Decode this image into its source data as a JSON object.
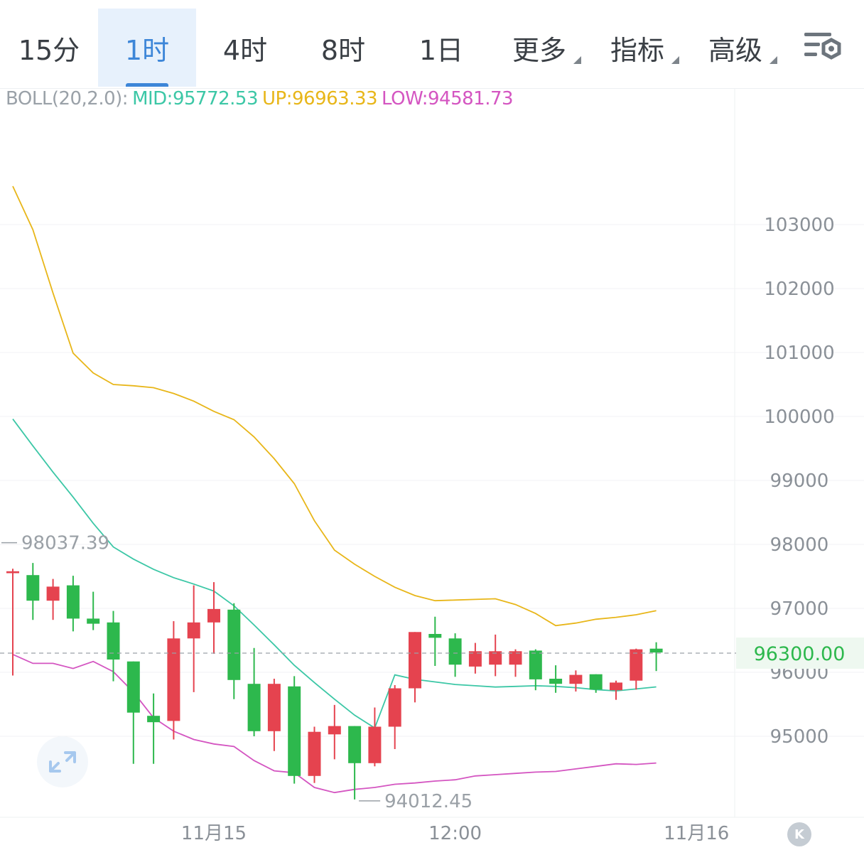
{
  "tabs": [
    {
      "label": "15分",
      "active": false,
      "has_dropdown": false
    },
    {
      "label": "1时",
      "active": true,
      "has_dropdown": false
    },
    {
      "label": "4时",
      "active": false,
      "has_dropdown": false
    },
    {
      "label": "8时",
      "active": false,
      "has_dropdown": false
    },
    {
      "label": "1日",
      "active": false,
      "has_dropdown": false
    },
    {
      "label": "更多",
      "active": false,
      "has_dropdown": true
    },
    {
      "label": "指标",
      "active": false,
      "has_dropdown": true
    },
    {
      "label": "高级",
      "active": false,
      "has_dropdown": true
    }
  ],
  "settings_icon": "chart-settings-icon",
  "indicator": {
    "name": "BOLL(20,2.0):",
    "mid": "MID:95772.53",
    "up": "UP:96963.33",
    "low": "LOW:94581.73"
  },
  "colors": {
    "up_candle": "#e5434f",
    "down_candle": "#2db84d",
    "mid": "#3cc7a6",
    "upper": "#e8b619",
    "lower": "#d455c1",
    "active_tab": "#3d86d8",
    "current_price": "#2db84d"
  },
  "current_price": "96300.00",
  "expand_icon": "expand-arrows-icon",
  "k_button_label": "K",
  "chart_data": {
    "type": "candlestick",
    "interval": "1h",
    "ylim": [
      93900,
      104000
    ],
    "y_ticks": [
      95000,
      96000,
      97000,
      98000,
      99000,
      100000,
      101000,
      102000,
      103000
    ],
    "y_tick_labels": [
      "95000",
      "96000",
      "97000",
      "98000",
      "99000",
      "100000",
      "101000",
      "102000",
      "103000"
    ],
    "x_labels": [
      {
        "label": "11月15",
        "index": 10
      },
      {
        "label": "12:00",
        "index": 22
      },
      {
        "label": "11月16",
        "index": 34
      }
    ],
    "annotations": {
      "high": {
        "label": "98037.39",
        "value": 98037.39,
        "index": 1
      },
      "low": {
        "label": "94012.45",
        "value": 94012.45,
        "index": 17
      }
    },
    "current_price": 96300.0,
    "candles": [
      {
        "o": 97550,
        "h": 97620,
        "l": 95950,
        "c": 97580
      },
      {
        "o": 97520,
        "h": 97710,
        "l": 96820,
        "c": 97120
      },
      {
        "o": 97120,
        "h": 97460,
        "l": 96820,
        "c": 97340
      },
      {
        "o": 97360,
        "h": 97510,
        "l": 96640,
        "c": 96840
      },
      {
        "o": 96840,
        "h": 97260,
        "l": 96660,
        "c": 96760
      },
      {
        "o": 96780,
        "h": 96960,
        "l": 95860,
        "c": 96200
      },
      {
        "o": 96170,
        "h": 96170,
        "l": 94570,
        "c": 95370
      },
      {
        "o": 95320,
        "h": 95670,
        "l": 94570,
        "c": 95220
      },
      {
        "o": 95240,
        "h": 96800,
        "l": 94950,
        "c": 96530
      },
      {
        "o": 96530,
        "h": 97360,
        "l": 95690,
        "c": 96780
      },
      {
        "o": 96780,
        "h": 97410,
        "l": 96290,
        "c": 96990
      },
      {
        "o": 96980,
        "h": 97080,
        "l": 95580,
        "c": 95880
      },
      {
        "o": 95820,
        "h": 96380,
        "l": 95000,
        "c": 95080
      },
      {
        "o": 95080,
        "h": 95900,
        "l": 94770,
        "c": 95820
      },
      {
        "o": 95780,
        "h": 95940,
        "l": 94260,
        "c": 94380
      },
      {
        "o": 94380,
        "h": 95150,
        "l": 94270,
        "c": 95070
      },
      {
        "o": 95030,
        "h": 95490,
        "l": 94640,
        "c": 95160
      },
      {
        "o": 95160,
        "h": 95160,
        "l": 94012.45,
        "c": 94580
      },
      {
        "o": 94580,
        "h": 95450,
        "l": 94530,
        "c": 95150
      },
      {
        "o": 95150,
        "h": 95800,
        "l": 94800,
        "c": 95750
      },
      {
        "o": 95750,
        "h": 96630,
        "l": 95530,
        "c": 96630
      },
      {
        "o": 96600,
        "h": 96870,
        "l": 96100,
        "c": 96540
      },
      {
        "o": 96530,
        "h": 96610,
        "l": 95930,
        "c": 96120
      },
      {
        "o": 96090,
        "h": 96460,
        "l": 95980,
        "c": 96330
      },
      {
        "o": 96120,
        "h": 96590,
        "l": 95940,
        "c": 96330
      },
      {
        "o": 96120,
        "h": 96360,
        "l": 95930,
        "c": 96330
      },
      {
        "o": 96340,
        "h": 96360,
        "l": 95720,
        "c": 95890
      },
      {
        "o": 95900,
        "h": 96110,
        "l": 95680,
        "c": 95820
      },
      {
        "o": 95820,
        "h": 96030,
        "l": 95700,
        "c": 95960
      },
      {
        "o": 95970,
        "h": 95970,
        "l": 95680,
        "c": 95730
      },
      {
        "o": 95720,
        "h": 95870,
        "l": 95570,
        "c": 95840
      },
      {
        "o": 95870,
        "h": 96370,
        "l": 95730,
        "c": 96360
      },
      {
        "o": 96370,
        "h": 96470,
        "l": 96020,
        "c": 96310
      }
    ],
    "bollinger": {
      "mid": [
        99960,
        99540,
        99130,
        98740,
        98330,
        97960,
        97770,
        97610,
        97480,
        97380,
        97270,
        97040,
        96740,
        96430,
        96110,
        95840,
        95580,
        95330,
        95130,
        95960,
        95890,
        95850,
        95810,
        95790,
        95770,
        95780,
        95790,
        95780,
        95760,
        95730,
        95710,
        95740,
        95772.53
      ],
      "upper": [
        103600,
        102920,
        101930,
        100990,
        100680,
        100500,
        100480,
        100450,
        100360,
        100240,
        100080,
        99950,
        99680,
        99340,
        98950,
        98370,
        97910,
        97690,
        97500,
        97330,
        97200,
        97120,
        97130,
        97140,
        97150,
        97060,
        96920,
        96730,
        96770,
        96830,
        96860,
        96900,
        96963.33
      ],
      "lower": [
        96280,
        96140,
        96140,
        96060,
        96170,
        96010,
        95690,
        95290,
        95080,
        94950,
        94880,
        94840,
        94620,
        94460,
        94430,
        94200,
        94120,
        94170,
        94200,
        94250,
        94270,
        94300,
        94320,
        94380,
        94400,
        94420,
        94440,
        94450,
        94490,
        94530,
        94570,
        94560,
        94581.73
      ]
    }
  }
}
